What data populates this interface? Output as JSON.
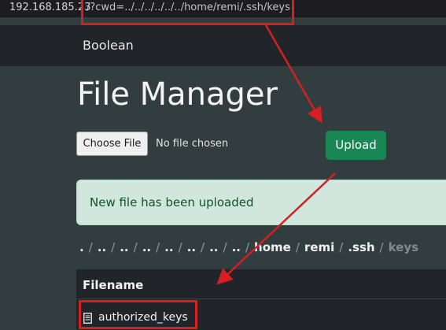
{
  "browser": {
    "url_host": "192.168.185.23",
    "url_path": "/?cwd=../../../../../../home/remi/.ssh/keys"
  },
  "navbar": {
    "brand": "Boolean"
  },
  "main": {
    "title": "File Manager",
    "choose_file_label": "Choose File",
    "no_file_text": "No file chosen",
    "upload_label": "Upload",
    "alert_text": "New file has been uploaded",
    "breadcrumb": [
      ".",
      "..",
      "..",
      "..",
      "..",
      "..",
      "..",
      "..",
      "home",
      "remi",
      ".ssh",
      "keys"
    ],
    "table": {
      "header": "Filename",
      "rows": [
        "authorized_keys"
      ]
    }
  },
  "annotations": {
    "color": "#d61f22"
  }
}
